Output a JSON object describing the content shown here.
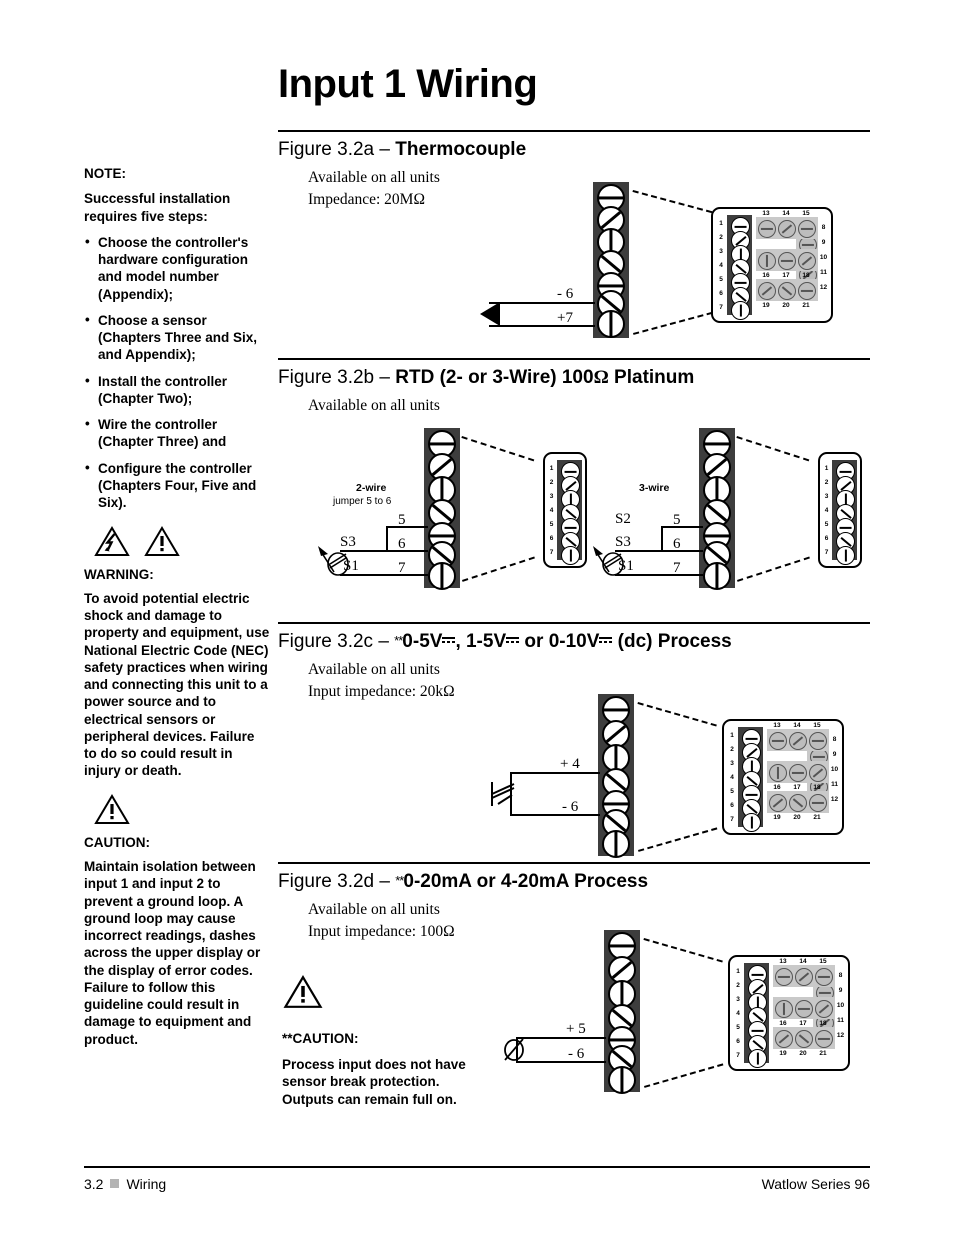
{
  "page": {
    "title": "Input 1 Wiring",
    "footer_left_num": "3.2",
    "footer_left_label": "Wiring",
    "footer_right": "Watlow Series 96"
  },
  "sidebar": {
    "note_heading": "NOTE:",
    "note_intro": "Successful installation requires five steps:",
    "bullet_char": "•",
    "steps": [
      "Choose the controller's hardware configuration and model number (Appendix);",
      "Choose a sensor (Chapters Three and Six, and Appendix);",
      "Install the controller (Chapter Two);",
      "Wire the controller (Chapter Three) and",
      "Configure the controller (Chapters Four, Five and Six)."
    ],
    "warning_heading": "WARNING:",
    "warning_body": "To avoid potential electric shock and damage to property and equipment, use National Electric Code (NEC) safety practices when wiring and connecting this unit to a power source and to electrical sensors or peripheral devices. Failure to do so could result in injury or death.",
    "caution_heading": "CAUTION:",
    "caution_body": "Maintain isolation between input 1 and input 2 to prevent a ground loop. A ground loop may cause incorrect readings, dashes across the upper display or the display of error codes. Failure to follow this guideline could result in damage to equipment and product."
  },
  "figures": {
    "a": {
      "label": "Figure 3.2a – ",
      "title": "Thermocouple",
      "line1": "Available on all units",
      "line2": "Impedance: 20MΩ",
      "wires": [
        {
          "label": "- 6"
        },
        {
          "label": "+7"
        }
      ]
    },
    "b": {
      "label": "Figure 3.2b – ",
      "title_pre": "RTD (2- or 3-Wire) 100",
      "title_ohm": "Ω",
      "title_post": " Platinum",
      "line1": "Available on all units",
      "two_wire": {
        "heading": "2-wire",
        "sub": "jumper 5 to 6",
        "sensor_labels": [
          "S3",
          "S1"
        ],
        "terminals": [
          "5",
          "6",
          "7"
        ]
      },
      "three_wire": {
        "heading": "3-wire",
        "sensor_labels": [
          "S2",
          "S3",
          "S1"
        ],
        "terminals": [
          "5",
          "6",
          "7"
        ]
      }
    },
    "c": {
      "label": "Figure 3.2c – ",
      "asterisks": "**",
      "title_parts": [
        "0-5V",
        ", 1-5V",
        " or 0-10V",
        " (dc) Process"
      ],
      "line1": "Available on all units",
      "line2": "Input impedance: 20kΩ",
      "wires": [
        {
          "label": "+  4"
        },
        {
          "label": "-  6"
        }
      ]
    },
    "d": {
      "label": "Figure 3.2d – ",
      "asterisks": "**",
      "title": "0-20mA or 4-20mA Process",
      "line1": "Available on all units",
      "line2": "Input impedance: 100Ω",
      "caution_heading": "**CAUTION:",
      "caution_body": "Process input does not have sensor break protection. Outputs can remain full on.",
      "wires": [
        {
          "label": "+  5"
        },
        {
          "label": "-  6"
        }
      ]
    }
  },
  "panel": {
    "left_terminals": [
      "1",
      "2",
      "3",
      "4",
      "5",
      "6",
      "7"
    ],
    "right_terminals": [
      "8",
      "9",
      "10",
      "11",
      "12"
    ],
    "block_top": [
      "13",
      "14",
      "15"
    ],
    "block_mid": [
      "16",
      "17",
      "18"
    ],
    "block_bot": [
      "19",
      "20",
      "21"
    ]
  },
  "colors": {
    "strip_dark": "#3d3d3d",
    "block_gray": "#c9c9c9",
    "footer_square": "#b3b3b3",
    "text": "#000000"
  }
}
